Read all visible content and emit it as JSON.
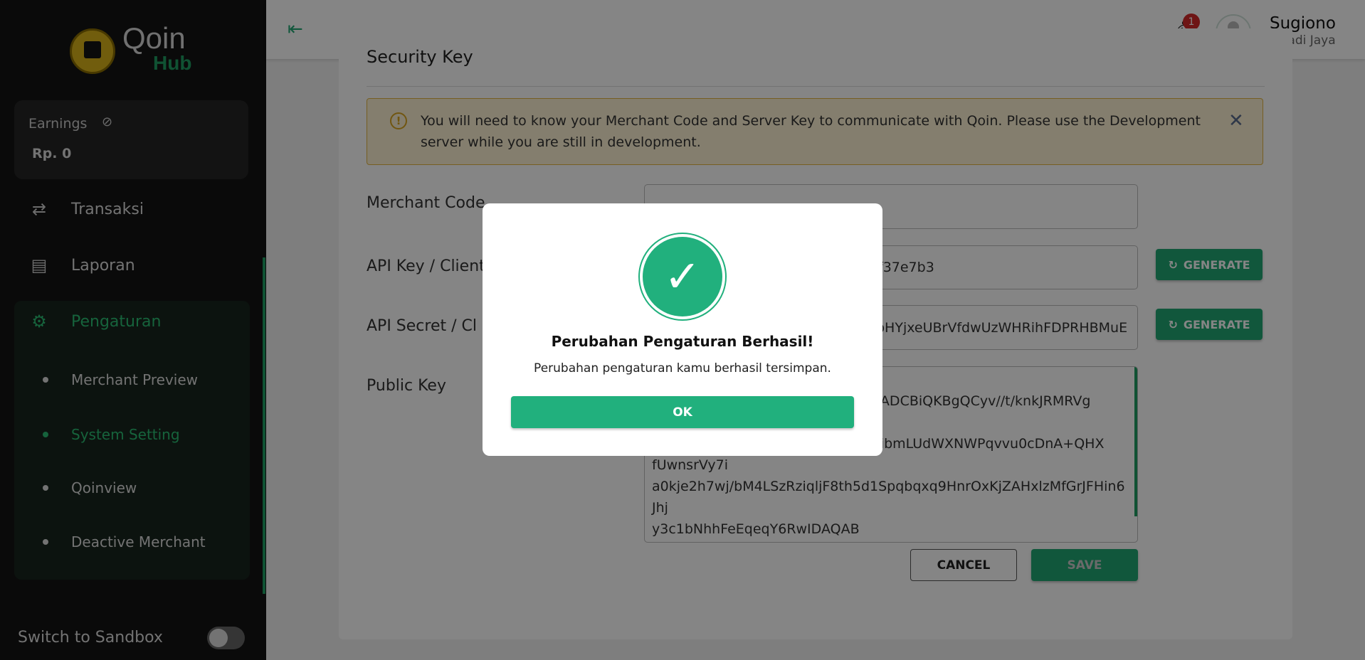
{
  "brand": {
    "name": "Qoin",
    "sub": "Hub",
    "accent": "#21b07d"
  },
  "sidebar": {
    "earnings_label": "Earnings",
    "earnings_value": "Rp. 0",
    "items": [
      {
        "label": "Transaksi",
        "icon": "repeat-icon"
      },
      {
        "label": "Laporan",
        "icon": "document-icon"
      },
      {
        "label": "Pengaturan",
        "icon": "gear-icon"
      }
    ],
    "subitems": [
      {
        "label": "Merchant Preview"
      },
      {
        "label": "System Setting"
      },
      {
        "label": "Qoinview"
      },
      {
        "label": "Deactive Merchant"
      }
    ],
    "sandbox_label": "Switch to Sandbox",
    "sandbox_on": false
  },
  "header": {
    "notification_count": "1",
    "user_name": "Sugiono",
    "user_company": "Abadi Jaya"
  },
  "card": {
    "title": "Security Key",
    "alert": "You will need to know your Merchant Code and Server Key to communicate with Qoin. Please use the Development server while you are still in development.",
    "fields": [
      {
        "label": "Merchant Code",
        "value": ""
      },
      {
        "label": "API Key / Client",
        "value": "f37e7b3"
      },
      {
        "label": "API Secret / Cl",
        "value": "pHYjxeUBrVfdwUzWHRihFDPRHBMuE"
      }
    ],
    "generate_label": "GENERATE",
    "public_key_label": "Public Key",
    "public_key_lines": [
      "GNADCBiQKBgQCyv//t/knkJRMRVg",
      "9PvibmLUdWXNWPqvvu0cDnA+QHX",
      "fUwnsrVy7i",
      "a0kje2h7wj/bM4LSzRziqljF8th5d1Spqbqxq9HnrOxKjZAHxlzMfGrJFHin6",
      "Jhj",
      "y3c1bNhhFeEqeqY6RwIDAQAB"
    ],
    "cancel_label": "CANCEL",
    "save_label": "SAVE"
  },
  "modal": {
    "title": "Perubahan Pengaturan Berhasil!",
    "message": "Perubahan pengaturan kamu berhasil tersimpan.",
    "ok_label": "OK"
  }
}
